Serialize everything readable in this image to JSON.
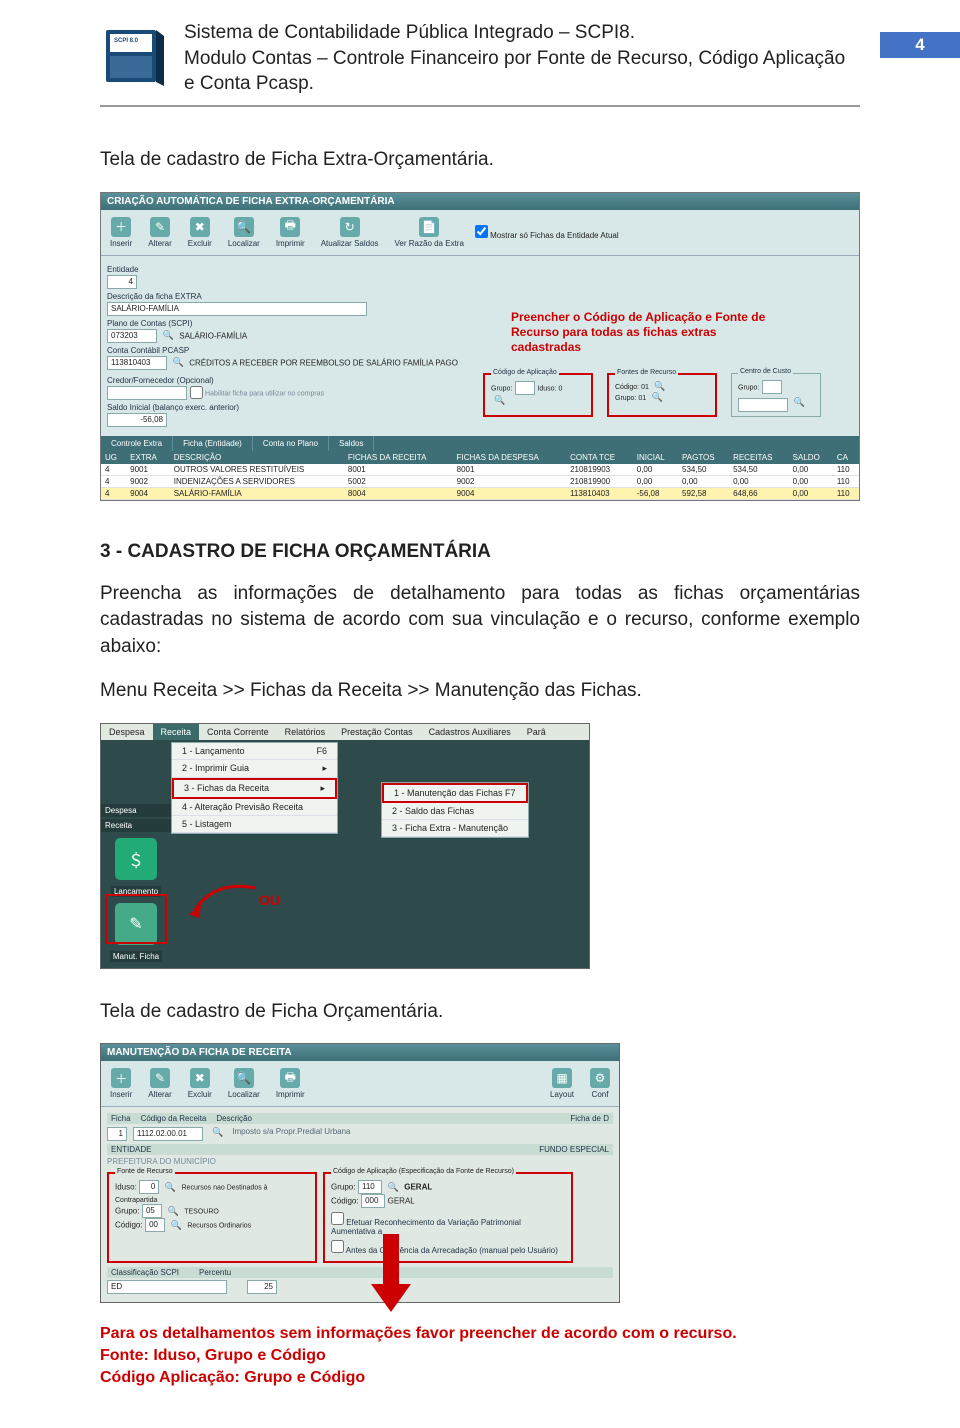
{
  "header": {
    "line1": "Sistema de Contabilidade Pública Integrado – SCPI8.",
    "line2": "Modulo Contas – Controle Financeiro por Fonte de Recurso, Código Aplicação e Conta Pcasp.",
    "page_number": "4"
  },
  "intro1": "Tela de cadastro de Ficha Extra-Orçamentária.",
  "shot1": {
    "title": "CRIAÇÃO AUTOMÁTICA DE FICHA EXTRA-ORÇAMENTÁRIA",
    "toolbar": [
      "Inserir",
      "Alterar",
      "Excluir",
      "Localizar",
      "Imprimir",
      "Atualizar Saldos",
      "Ver Razão da Extra"
    ],
    "toolbar_icons": [
      "＋",
      "✎",
      "✖",
      "🔍",
      "🖶",
      "↻",
      "📄"
    ],
    "chk_mostrar": "Mostrar só Fichas da Entidade Atual",
    "fields": {
      "entidade_label": "Entidade",
      "entidade_val": "4",
      "descr_label": "Descrição da ficha EXTRA",
      "descr_val": "SALÁRIO-FAMÍLIA",
      "plano_label": "Plano de Contas (SCPI)",
      "plano_code": "073203",
      "plano_text": "SALÁRIO-FAMÍLIA",
      "conta_label": "Conta Contábil PCASP",
      "conta_code": "113810403",
      "conta_text": "CRÉDITOS A RECEBER POR REEMBOLSO DE SALÁRIO FAMÍLIA PAGO",
      "credor_label": "Credor/Fornecedor (Opcional)",
      "credor_chk": "Habilitar ficha para utilizar no compras",
      "saldo_label": "Saldo Inicial (balanço exerc. anterior)",
      "saldo_val": "-56,08"
    },
    "grp_codapp": {
      "title": "Código de Aplicação",
      "l1": "Grupo:",
      "l2": "Iduso: 0"
    },
    "grp_fonte": {
      "title": "Fontes de Recurso",
      "l1": "Código: 01",
      "l2": "Grupo: 01"
    },
    "grp_centro": {
      "title": "Centro de Custo",
      "l1": "Grupo:"
    },
    "tabs": [
      "Controle Extra",
      "Ficha (Entidade)",
      "Conta no Plano",
      "Saldos"
    ],
    "cols": [
      "UG",
      "EXTRA",
      "DESCRIÇÃO",
      "FICHAS DA RECEITA",
      "FICHAS DA DESPESA",
      "CONTA TCE",
      "INICIAL",
      "PAGTOS",
      "RECEITAS",
      "SALDO",
      "CA"
    ],
    "rows": [
      [
        "4",
        "9001",
        "OUTROS VALORES RESTITUÍVEIS",
        "8001",
        "8001",
        "210819903",
        "0,00",
        "534,50",
        "534,50",
        "0,00",
        "110"
      ],
      [
        "4",
        "9002",
        "INDENIZAÇÕES A SERVIDORES",
        "5002",
        "9002",
        "210819900",
        "0,00",
        "0,00",
        "0,00",
        "0,00",
        "110"
      ],
      [
        "4",
        "9004",
        "SALÁRIO-FAMÍLIA",
        "8004",
        "9004",
        "113810403",
        "-56,08",
        "592,58",
        "648,66",
        "0,00",
        "110"
      ]
    ],
    "callout": "Preencher o Código de Aplicação e Fonte de Recurso para todas as fichas extras cadastradas"
  },
  "section3_title": "3 - CADASTRO DE FICHA ORÇAMENTÁRIA",
  "section3_p": "Preencha as informações de detalhamento para todas as fichas orçamentárias cadastradas no sistema de acordo com sua vinculação e o recurso, conforme exemplo abaixo:",
  "section3_menu": "Menu Receita >> Fichas da Receita >> Manutenção das Fichas.",
  "shot2": {
    "menubar": [
      "Despesa",
      "Receita",
      "Conta Corrente",
      "Relatórios",
      "Prestação Contas",
      "Cadastros Auxiliares",
      "Parâ"
    ],
    "submenu": [
      {
        "t": "1 - Lançamento",
        "s": "F6"
      },
      {
        "t": "2 - Imprimir Guia",
        "s": "▸"
      },
      {
        "t": "3 - Fichas da Receita",
        "s": "▸",
        "hl": true
      },
      {
        "t": "4 - Alteração Previsão Receita",
        "s": ""
      },
      {
        "t": "5 - Listagem",
        "s": ""
      }
    ],
    "submenu2": [
      {
        "t": "1 - Manutenção das Fichas   F7",
        "hl": true
      },
      {
        "t": "2 - Saldo das Fichas"
      },
      {
        "t": "3 - Ficha Extra - Manutenção"
      }
    ],
    "side_items": [
      "Despesa",
      "Receita"
    ],
    "side_icons": [
      {
        "label": "Lançamento",
        "glyph": "＄"
      },
      {
        "label": "Manut. Ficha",
        "glyph": "✎"
      }
    ],
    "ou": "OU"
  },
  "intro3": "Tela de cadastro de Ficha Orçamentária.",
  "shot3": {
    "title": "MANUTENÇÃO DA FICHA DE RECEITA",
    "toolbar": [
      "Inserir",
      "Alterar",
      "Excluir",
      "Localizar",
      "Imprimir",
      "Layout",
      "Conf"
    ],
    "toolbar_icons": [
      "＋",
      "✎",
      "✖",
      "🔍",
      "🖶",
      "▦",
      "⚙"
    ],
    "hdr": {
      "ficha": "Ficha",
      "cod": "Código da Receita",
      "desc": "Descrição",
      "fichad": "Ficha de D"
    },
    "vals": {
      "ficha": "1",
      "cod": "1112.02.00.01",
      "desc": "Imposto s/a Propr.Predial Urbana"
    },
    "ent_label": "ENTIDADE",
    "ent_val": "PREFEITURA DO MUNICÍPIO",
    "fundo": "FUNDO ESPECIAL",
    "fonte": {
      "title": "Fonte de Recurso",
      "iduso": "Iduso:",
      "iduso_v": "0",
      "iduso_t": "Recursos nao Destinados à Contrapartida",
      "grupo": "Grupo:",
      "grupo_v": "05",
      "grupo_t": "TESOURO",
      "cod": "Código:",
      "cod_v": "00",
      "cod_t": "Recursos Ordinarios"
    },
    "codapp": {
      "title": "Código de Aplicação (Especificação da Fonte de Recurso)",
      "grupo": "Grupo:",
      "grupo_v": "110",
      "grupo_t": "GERAL",
      "cod": "Código:",
      "cod_v": "000",
      "cod_t": "GERAL"
    },
    "efetuar": "Efetuar Reconhecimento da Variação Patrimonial Aumentativa a",
    "antes": "Antes da Ocorrência da Arrecadação (manual pelo Usuário)",
    "class": "Classificação SCPI",
    "percent": "Percentu",
    "ed": "ED",
    "pct_v": "25"
  },
  "bottom": {
    "l1": "Para os detalhamentos sem informações favor preencher de acordo com o recurso.",
    "l2": "Fonte: Iduso, Grupo e Código",
    "l3": "Código Aplicação: Grupo e Código"
  }
}
